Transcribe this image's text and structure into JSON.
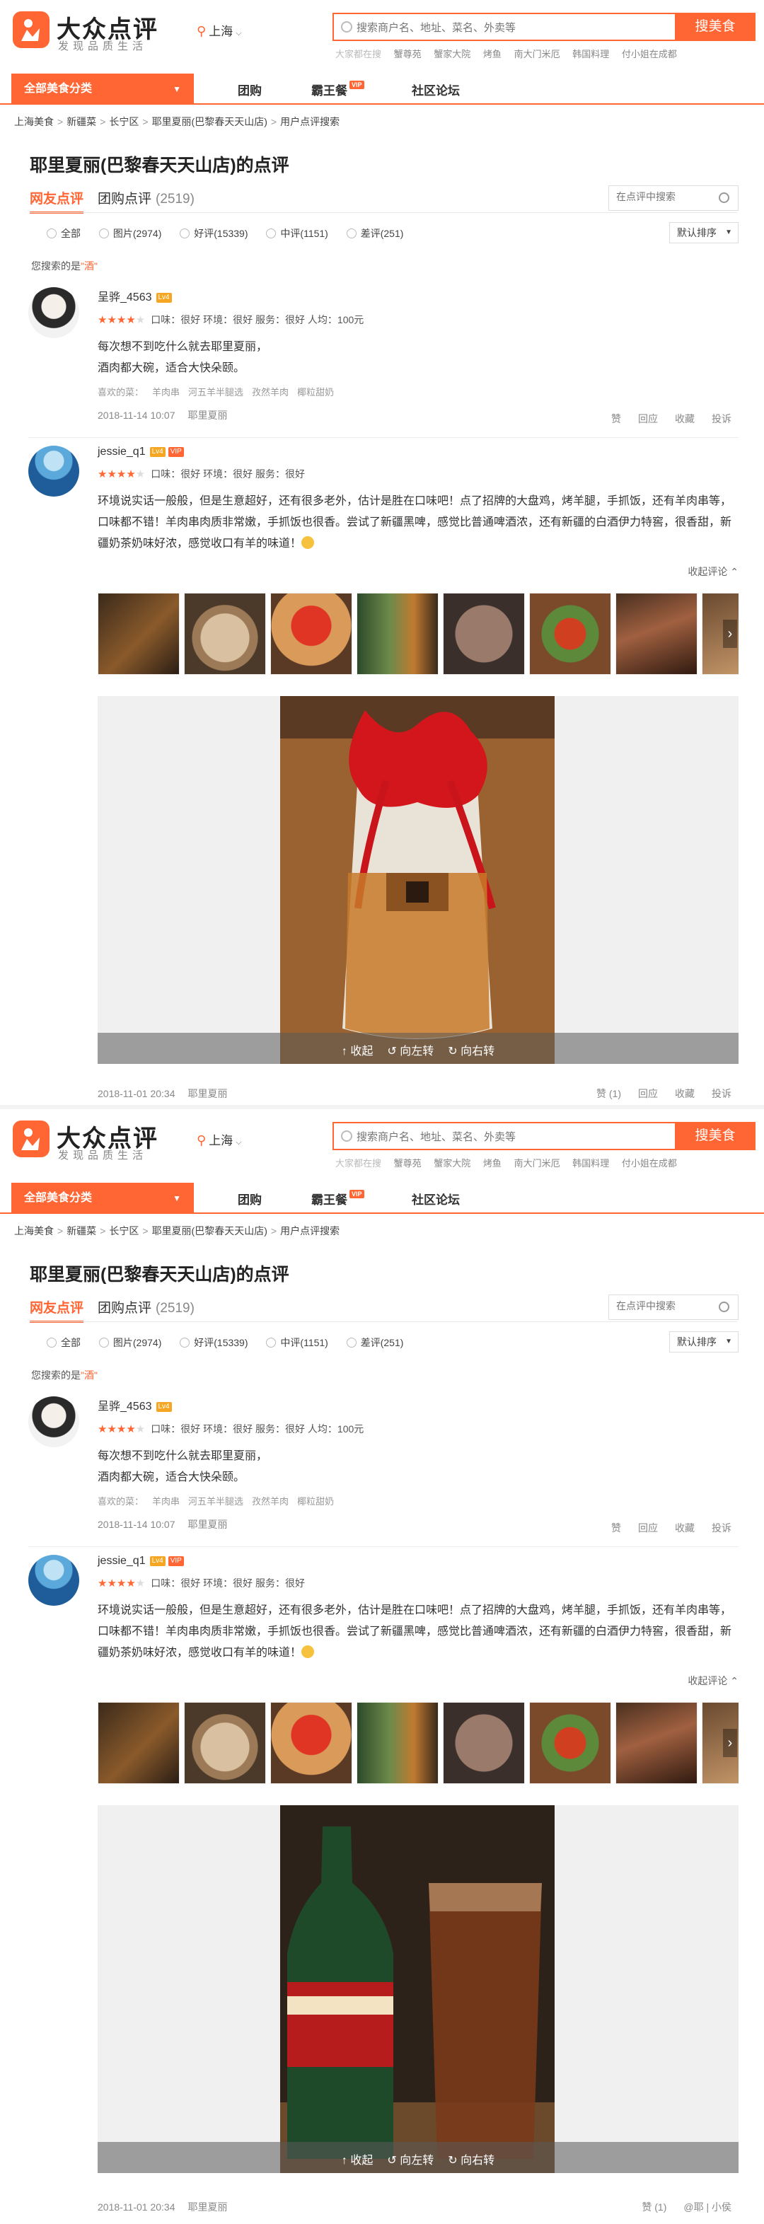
{
  "header": {
    "logo_title": "大众点评",
    "logo_slogan": "发现品质生活",
    "city": "上海",
    "search_placeholder": "搜索商户名、地址、菜名、外卖等",
    "search_button": "搜美食",
    "hot_lead": "大家都在搜",
    "hot_keywords": [
      "蟹尊苑",
      "蟹家大院",
      "烤鱼",
      "南大门米厄",
      "韩国料理",
      "付小姐在成都"
    ]
  },
  "nav": {
    "category": "全部美食分类",
    "links": [
      "团购",
      "霸王餐",
      "社区论坛"
    ],
    "vip_tag": "VIP"
  },
  "breadcrumb": [
    "上海美食",
    "新疆菜",
    "长宁区",
    "耶里夏丽(巴黎春天天山店)",
    "用户点评搜索"
  ],
  "page_title": "耶里夏丽(巴黎春天天山店)的点评",
  "tabs": {
    "reviews": "网友点评",
    "group_label": "团购点评",
    "group_count": "(2519)"
  },
  "review_search_placeholder": "在点评中搜索",
  "filters": [
    "全部",
    "图片(2974)",
    "好评(15339)",
    "中评(1151)",
    "差评(251)"
  ],
  "sort_label": "默认排序",
  "hint": {
    "prefix": "您搜索的是",
    "keyword": "\"酒\""
  },
  "review1": {
    "user": "呈骅_4563",
    "level": "Lv4",
    "scores": "口味：很好  环境：很好  服务：很好  人均：100元",
    "text_line1": "每次想不到吃什么就去耶里夏丽，",
    "text_line2": "酒肉都大碗，适合大快朵颐。",
    "likes_label": "喜欢的菜：",
    "likes": [
      "羊肉串",
      "河五羊半腿选",
      "孜然羊肉",
      "椰粒甜奶"
    ],
    "date": "2018-11-14 10:07",
    "shop": "耶里夏丽",
    "actions": [
      "赞",
      "回应",
      "收藏",
      "投诉"
    ]
  },
  "review2": {
    "user": "jessie_q1",
    "level": "Lv4",
    "vip": "VIP",
    "scores": "口味：很好  环境：很好  服务：很好",
    "text": "环境说实话一般般，但是生意超好，还有很多老外，估计是胜在口味吧！点了招牌的大盘鸡，烤羊腿，手抓饭，还有羊肉串等，口味都不错！羊肉串肉质非常嫩，手抓饭也很香。尝试了新疆黑啤，感觉比普通啤酒浓，还有新疆的白酒伊力特窖，很香甜，新疆奶茶奶味好浓，感觉收口有羊的味道！",
    "collapse": "收起评论 ⌃",
    "viewer_buttons": [
      "↑ 收起",
      "↺ 向左转",
      "↻ 向右转"
    ],
    "date": "2018-11-01 20:34",
    "shop": "耶里夏丽",
    "actions": [
      "赞 (1)",
      "回应",
      "收藏",
      "投诉"
    ]
  },
  "watermark": "@耶 | 小侯"
}
